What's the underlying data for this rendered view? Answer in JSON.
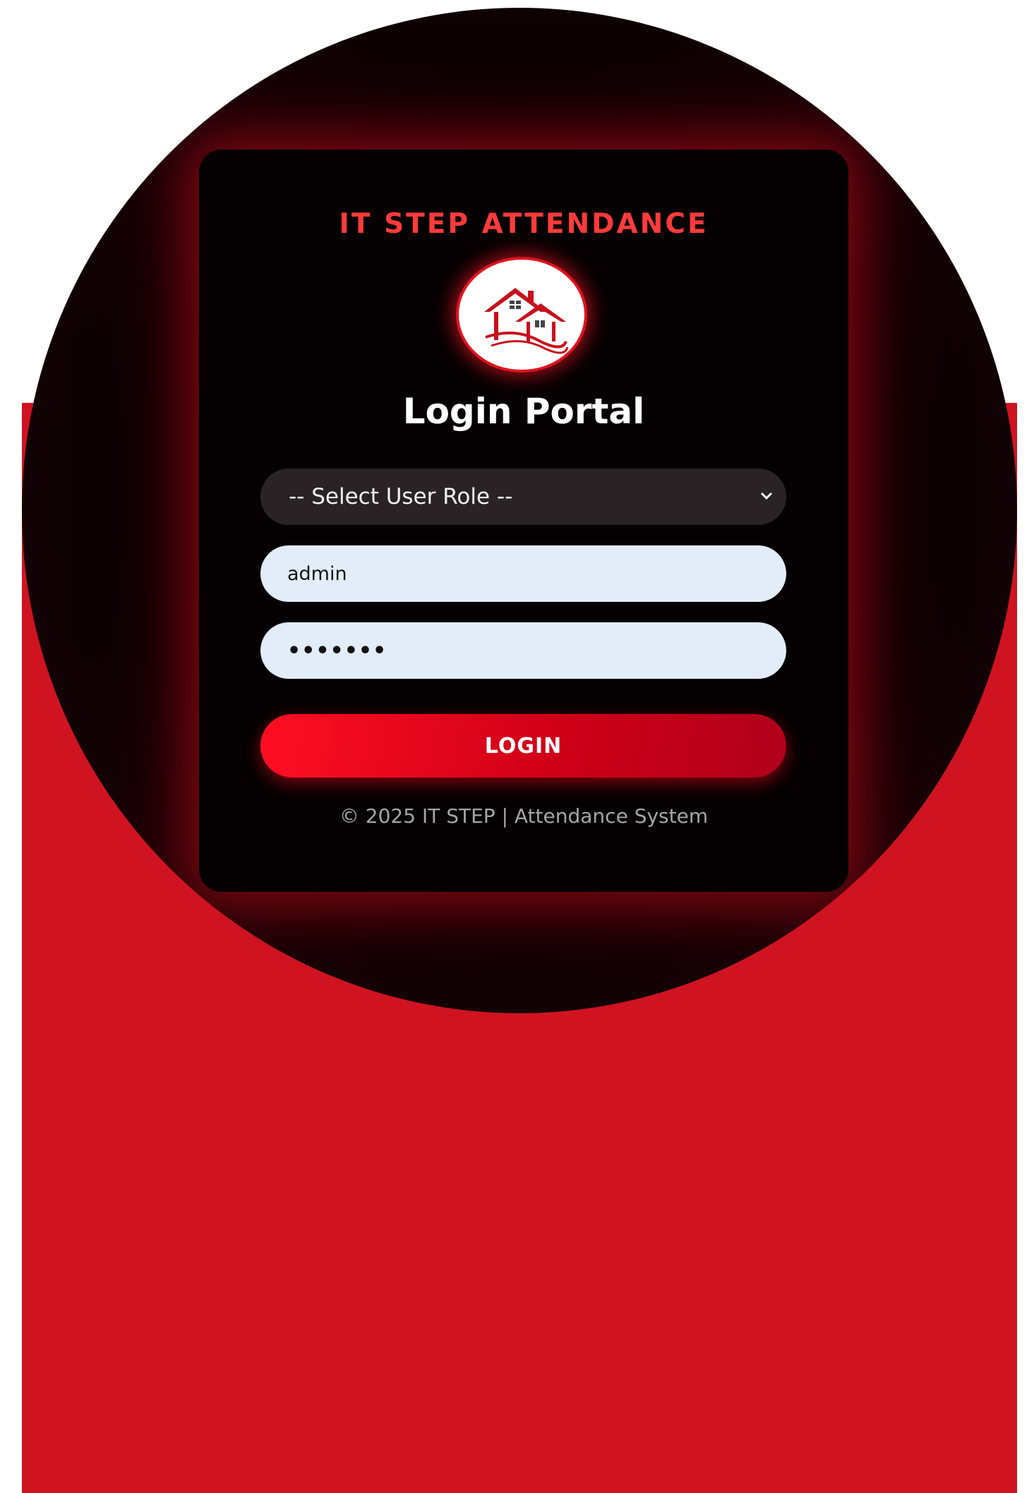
{
  "brand": {
    "name": "IT STEP ATTENDANCE",
    "logo_icon": "houses-logo-icon"
  },
  "form": {
    "title": "Login Portal",
    "role_select": {
      "selected": "-- Select User Role --",
      "icon": "chevron-down-icon"
    },
    "username": {
      "value": "admin"
    },
    "password": {
      "value": "•••••••"
    },
    "login_label": "LOGIN"
  },
  "footer": {
    "text": "© 2025 IT STEP | Attendance System"
  },
  "colors": {
    "accent": "#ff3b3b",
    "background_red": "#d01320",
    "card": "#050002",
    "input_bg": "#e3edf9",
    "select_bg": "#2a2325",
    "button_start": "#ff0f23",
    "button_end": "#b0001a"
  }
}
